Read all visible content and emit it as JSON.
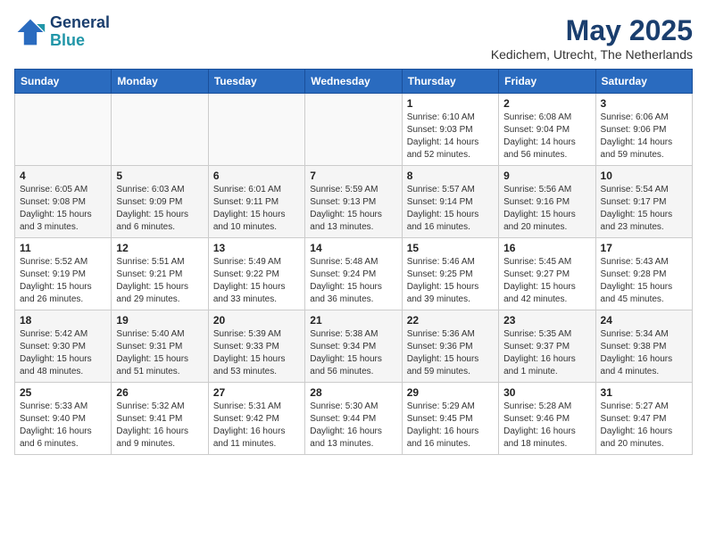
{
  "header": {
    "logo_line1": "General",
    "logo_line2": "Blue",
    "month": "May 2025",
    "location": "Kedichem, Utrecht, The Netherlands"
  },
  "weekdays": [
    "Sunday",
    "Monday",
    "Tuesday",
    "Wednesday",
    "Thursday",
    "Friday",
    "Saturday"
  ],
  "weeks": [
    [
      {
        "day": "",
        "content": ""
      },
      {
        "day": "",
        "content": ""
      },
      {
        "day": "",
        "content": ""
      },
      {
        "day": "",
        "content": ""
      },
      {
        "day": "1",
        "content": "Sunrise: 6:10 AM\nSunset: 9:03 PM\nDaylight: 14 hours\nand 52 minutes."
      },
      {
        "day": "2",
        "content": "Sunrise: 6:08 AM\nSunset: 9:04 PM\nDaylight: 14 hours\nand 56 minutes."
      },
      {
        "day": "3",
        "content": "Sunrise: 6:06 AM\nSunset: 9:06 PM\nDaylight: 14 hours\nand 59 minutes."
      }
    ],
    [
      {
        "day": "4",
        "content": "Sunrise: 6:05 AM\nSunset: 9:08 PM\nDaylight: 15 hours\nand 3 minutes."
      },
      {
        "day": "5",
        "content": "Sunrise: 6:03 AM\nSunset: 9:09 PM\nDaylight: 15 hours\nand 6 minutes."
      },
      {
        "day": "6",
        "content": "Sunrise: 6:01 AM\nSunset: 9:11 PM\nDaylight: 15 hours\nand 10 minutes."
      },
      {
        "day": "7",
        "content": "Sunrise: 5:59 AM\nSunset: 9:13 PM\nDaylight: 15 hours\nand 13 minutes."
      },
      {
        "day": "8",
        "content": "Sunrise: 5:57 AM\nSunset: 9:14 PM\nDaylight: 15 hours\nand 16 minutes."
      },
      {
        "day": "9",
        "content": "Sunrise: 5:56 AM\nSunset: 9:16 PM\nDaylight: 15 hours\nand 20 minutes."
      },
      {
        "day": "10",
        "content": "Sunrise: 5:54 AM\nSunset: 9:17 PM\nDaylight: 15 hours\nand 23 minutes."
      }
    ],
    [
      {
        "day": "11",
        "content": "Sunrise: 5:52 AM\nSunset: 9:19 PM\nDaylight: 15 hours\nand 26 minutes."
      },
      {
        "day": "12",
        "content": "Sunrise: 5:51 AM\nSunset: 9:21 PM\nDaylight: 15 hours\nand 29 minutes."
      },
      {
        "day": "13",
        "content": "Sunrise: 5:49 AM\nSunset: 9:22 PM\nDaylight: 15 hours\nand 33 minutes."
      },
      {
        "day": "14",
        "content": "Sunrise: 5:48 AM\nSunset: 9:24 PM\nDaylight: 15 hours\nand 36 minutes."
      },
      {
        "day": "15",
        "content": "Sunrise: 5:46 AM\nSunset: 9:25 PM\nDaylight: 15 hours\nand 39 minutes."
      },
      {
        "day": "16",
        "content": "Sunrise: 5:45 AM\nSunset: 9:27 PM\nDaylight: 15 hours\nand 42 minutes."
      },
      {
        "day": "17",
        "content": "Sunrise: 5:43 AM\nSunset: 9:28 PM\nDaylight: 15 hours\nand 45 minutes."
      }
    ],
    [
      {
        "day": "18",
        "content": "Sunrise: 5:42 AM\nSunset: 9:30 PM\nDaylight: 15 hours\nand 48 minutes."
      },
      {
        "day": "19",
        "content": "Sunrise: 5:40 AM\nSunset: 9:31 PM\nDaylight: 15 hours\nand 51 minutes."
      },
      {
        "day": "20",
        "content": "Sunrise: 5:39 AM\nSunset: 9:33 PM\nDaylight: 15 hours\nand 53 minutes."
      },
      {
        "day": "21",
        "content": "Sunrise: 5:38 AM\nSunset: 9:34 PM\nDaylight: 15 hours\nand 56 minutes."
      },
      {
        "day": "22",
        "content": "Sunrise: 5:36 AM\nSunset: 9:36 PM\nDaylight: 15 hours\nand 59 minutes."
      },
      {
        "day": "23",
        "content": "Sunrise: 5:35 AM\nSunset: 9:37 PM\nDaylight: 16 hours\nand 1 minute."
      },
      {
        "day": "24",
        "content": "Sunrise: 5:34 AM\nSunset: 9:38 PM\nDaylight: 16 hours\nand 4 minutes."
      }
    ],
    [
      {
        "day": "25",
        "content": "Sunrise: 5:33 AM\nSunset: 9:40 PM\nDaylight: 16 hours\nand 6 minutes."
      },
      {
        "day": "26",
        "content": "Sunrise: 5:32 AM\nSunset: 9:41 PM\nDaylight: 16 hours\nand 9 minutes."
      },
      {
        "day": "27",
        "content": "Sunrise: 5:31 AM\nSunset: 9:42 PM\nDaylight: 16 hours\nand 11 minutes."
      },
      {
        "day": "28",
        "content": "Sunrise: 5:30 AM\nSunset: 9:44 PM\nDaylight: 16 hours\nand 13 minutes."
      },
      {
        "day": "29",
        "content": "Sunrise: 5:29 AM\nSunset: 9:45 PM\nDaylight: 16 hours\nand 16 minutes."
      },
      {
        "day": "30",
        "content": "Sunrise: 5:28 AM\nSunset: 9:46 PM\nDaylight: 16 hours\nand 18 minutes."
      },
      {
        "day": "31",
        "content": "Sunrise: 5:27 AM\nSunset: 9:47 PM\nDaylight: 16 hours\nand 20 minutes."
      }
    ]
  ]
}
